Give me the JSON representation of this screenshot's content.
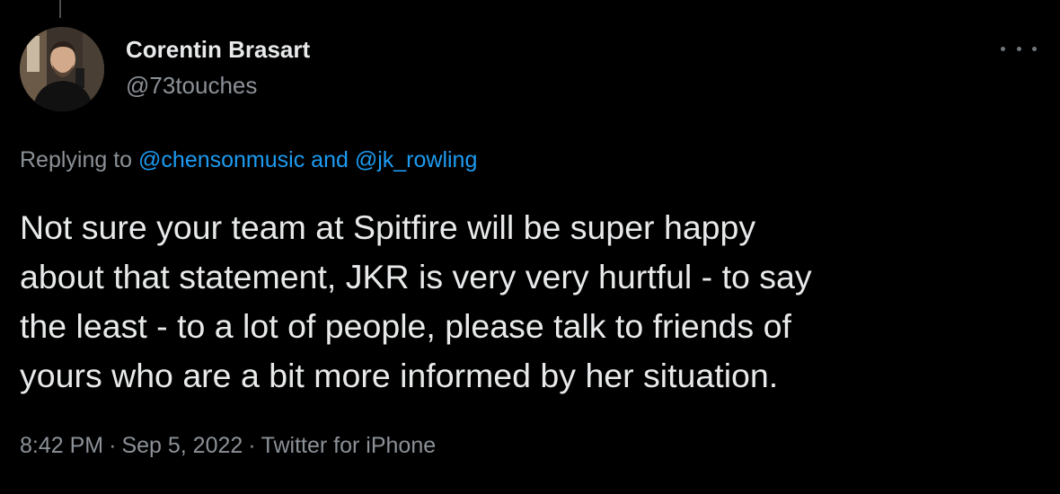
{
  "tweet": {
    "author_name": "Corentin Brasart",
    "author_handle": "@73touches",
    "replying_prefix": "Replying to ",
    "replying_user_1": "@chensonmusic",
    "replying_and": " and ",
    "replying_user_2": "@jk_rowling",
    "text": "Not sure your team at Spitfire will be super happy\nabout that statement, JKR is very very hurtful - to say\nthe least - to a lot of people, please talk to friends of\nyours who are a bit more informed by her situation.",
    "time": "8:42 PM",
    "separator": "·",
    "date": "Sep 5, 2022",
    "source": "Twitter for iPhone",
    "more_icon": "more-horizontal-icon"
  },
  "colors": {
    "background": "#000000",
    "primary_text": "#e7e9ea",
    "secondary_text": "#8b9197",
    "link": "#1d9bf0"
  }
}
